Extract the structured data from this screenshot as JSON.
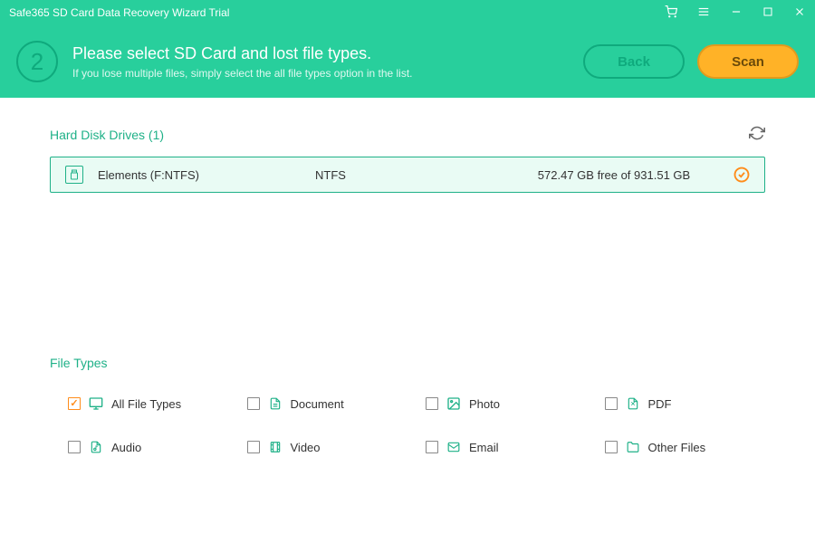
{
  "titlebar": {
    "title": "Safe365 SD Card Data Recovery Wizard Trial"
  },
  "header": {
    "step": "2",
    "title": "Please select SD Card and lost file types.",
    "subtitle": "If you lose multiple files, simply select the all file types option in the list.",
    "back": "Back",
    "scan": "Scan"
  },
  "drives": {
    "section": "Hard Disk Drives (1)",
    "items": [
      {
        "name": "Elements (F:NTFS)",
        "fs": "NTFS",
        "space": "572.47 GB free of 931.51 GB",
        "selected": true
      }
    ]
  },
  "filetypes": {
    "section": "File Types",
    "items": [
      {
        "label": "All File Types",
        "icon": "monitor",
        "checked": true
      },
      {
        "label": "Document",
        "icon": "document",
        "checked": false
      },
      {
        "label": "Photo",
        "icon": "photo",
        "checked": false
      },
      {
        "label": "PDF",
        "icon": "pdf",
        "checked": false
      },
      {
        "label": "Audio",
        "icon": "audio",
        "checked": false
      },
      {
        "label": "Video",
        "icon": "video",
        "checked": false
      },
      {
        "label": "Email",
        "icon": "email",
        "checked": false
      },
      {
        "label": "Other Files",
        "icon": "folder",
        "checked": false
      }
    ]
  }
}
